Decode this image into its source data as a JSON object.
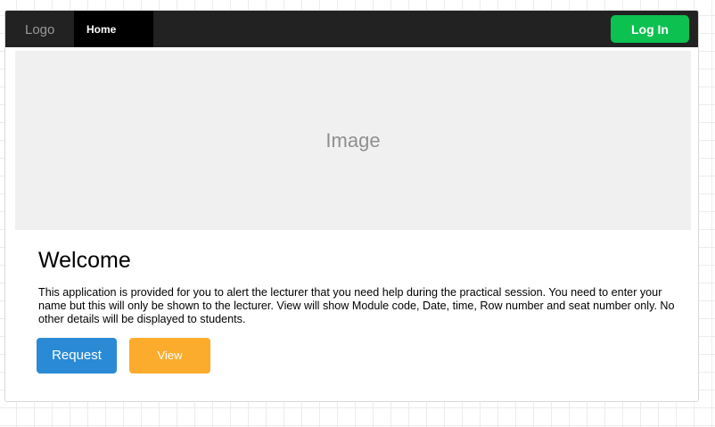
{
  "navbar": {
    "logo_text": "Logo",
    "home_label": "Home",
    "login_label": "Log In"
  },
  "hero": {
    "placeholder_text": "Image"
  },
  "main": {
    "title": "Welcome",
    "description": "This application is provided for you to alert the lecturer that you need help during the practical session.  You need to enter your name but this will only be shown to the lecturer.  View will show Module code, Date, time, Row number and seat number only.  No other details will be displayed to students."
  },
  "actions": {
    "request_label": "Request",
    "view_label": "View"
  },
  "colors": {
    "navbar_bg": "#222222",
    "login_green": "#0cc150",
    "request_blue": "#2a8ad6",
    "view_orange": "#fbac2c"
  }
}
